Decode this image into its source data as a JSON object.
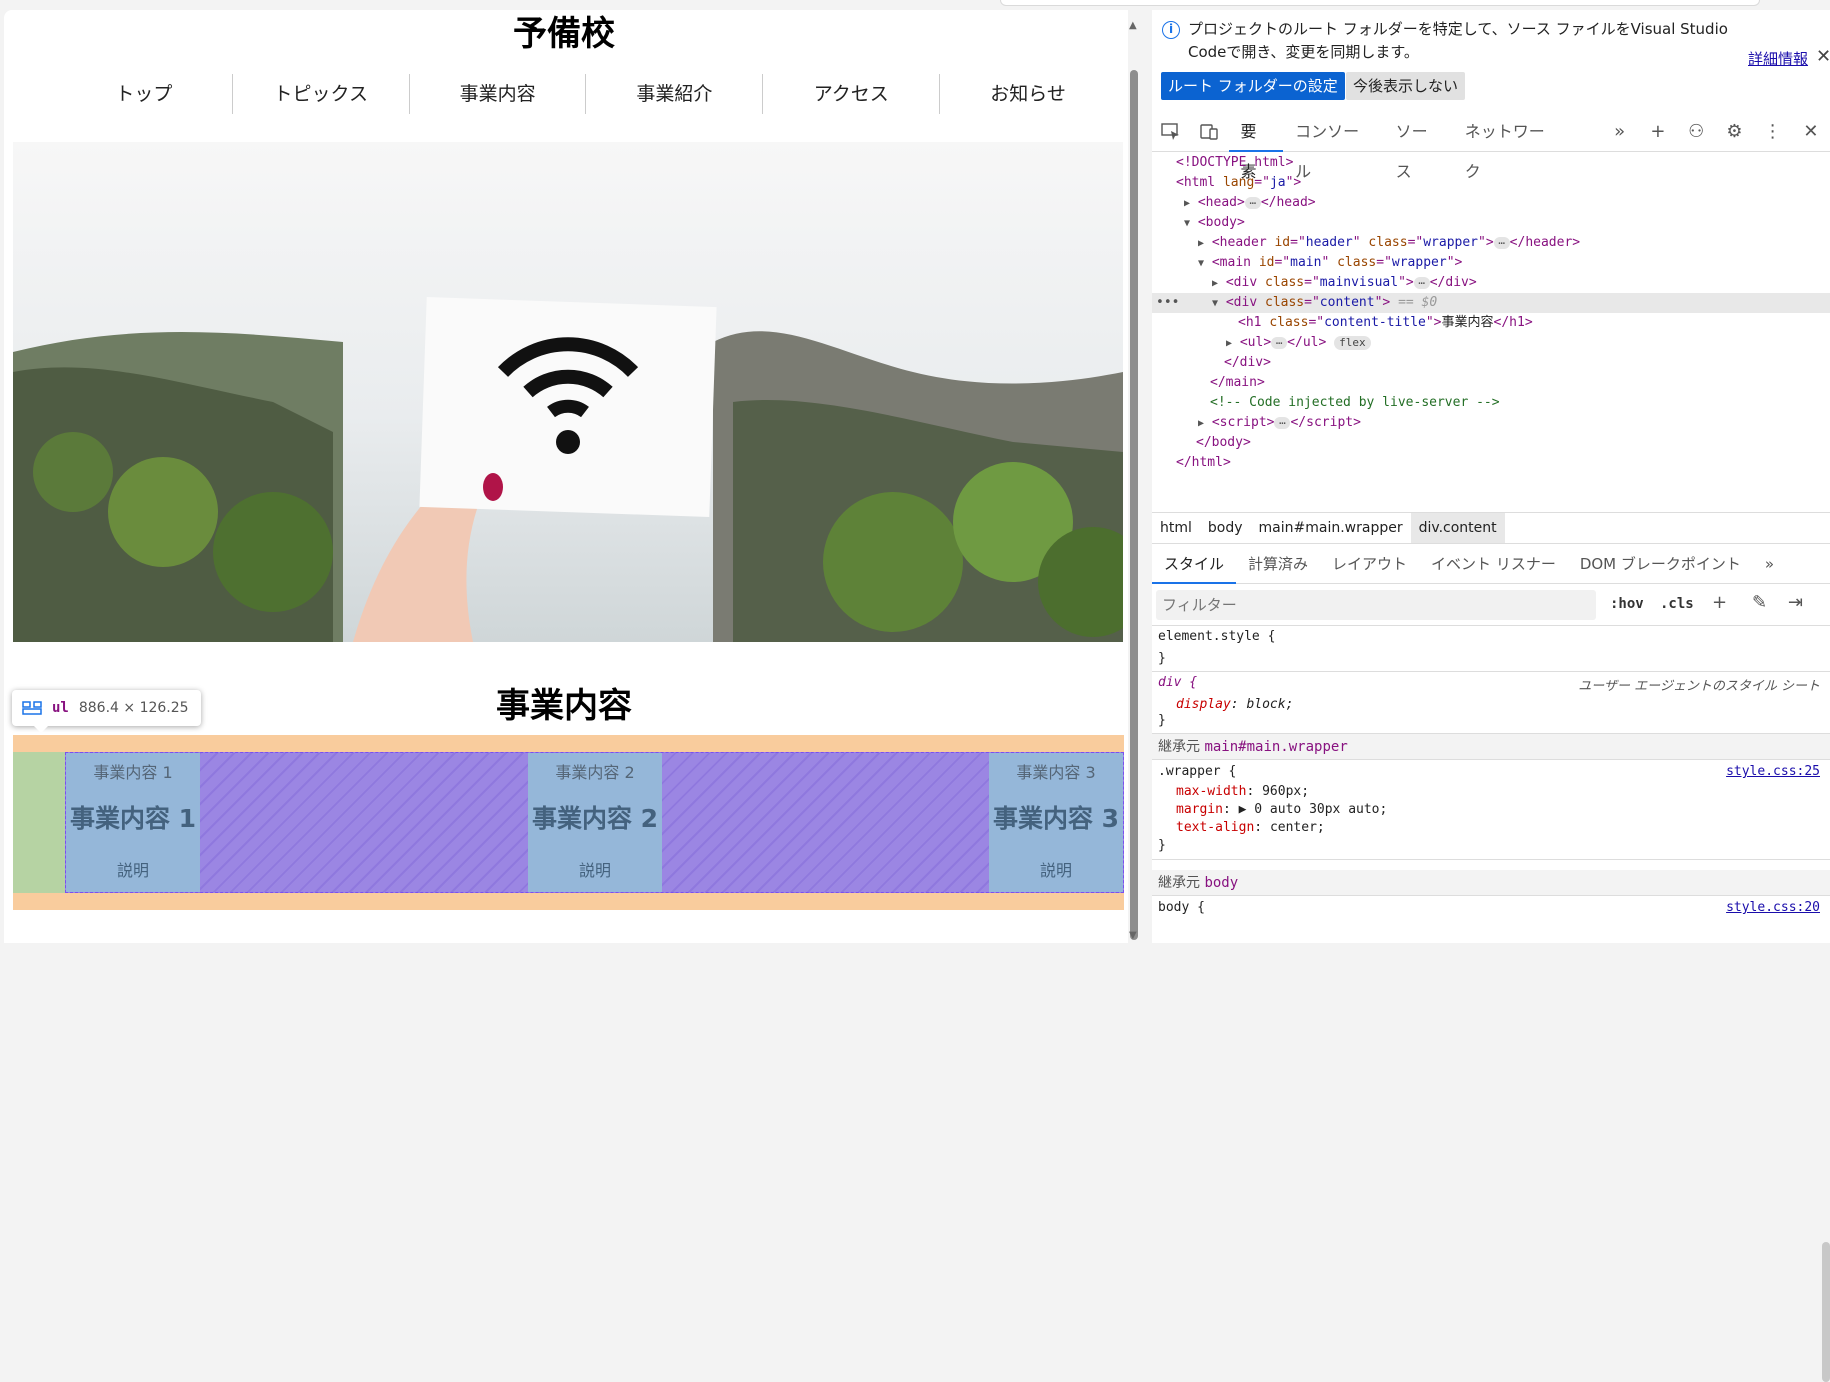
{
  "site": {
    "title": "予備校",
    "nav": [
      "トップ",
      "トピックス",
      "事業内容",
      "事業紹介",
      "アクセス",
      "お知らせ"
    ],
    "content_title": "事業内容",
    "items": [
      {
        "img_alt": "事業内容 1",
        "heading": "事業内容 1",
        "desc": "説明"
      },
      {
        "img_alt": "事業内容 2",
        "heading": "事業内容 2",
        "desc": "説明"
      },
      {
        "img_alt": "事業内容 3",
        "heading": "事業内容 3",
        "desc": "説明"
      }
    ]
  },
  "tooltip": {
    "tag": "ul",
    "size": "886.4 × 126.25"
  },
  "infobar": {
    "message": "プロジェクトのルート フォルダーを特定して、ソース ファイルをVisual Studio Codeで開き、変更を同期します。",
    "link": "詳細情報",
    "primary_button": "ルート フォルダーの設定",
    "secondary_button": "今後表示しない"
  },
  "toolbar": {
    "tabs": [
      "要素",
      "コンソール",
      "ソース",
      "ネットワーク"
    ],
    "active": "要素"
  },
  "dom": {
    "doctype": "<!DOCTYPE html>",
    "html_lang": "ja",
    "header_id": "header",
    "header_class": "wrapper",
    "main_id": "main",
    "main_class": "wrapper",
    "mainvisual_class": "mainvisual",
    "content_class": "content",
    "selected_marker": "== $0",
    "h1_class": "content-title",
    "h1_text": "事業内容",
    "ul_badge": "flex",
    "comment": "<!-- Code injected by live-server -->"
  },
  "breadcrumbs": [
    "html",
    "body",
    "main#main.wrapper",
    "div.content"
  ],
  "subtabs": [
    "スタイル",
    "計算済み",
    "レイアウト",
    "イベント リスナー",
    "DOM ブレークポイント"
  ],
  "filter": {
    "placeholder": "フィルター",
    "hov": ":hov",
    "cls": ".cls"
  },
  "styles": {
    "element_style": "element.style {",
    "div_selector": "div {",
    "ua_label": "ユーザー エージェントのスタイル シート",
    "div_prop": "display",
    "div_val": "block;",
    "inherit1_label": "継承元",
    "inherit1_target": "main#main.wrapper",
    "wrapper_selector": ".wrapper {",
    "wrapper_src": "style.css:25",
    "wrapper_props": [
      {
        "prop": "max-width",
        "val": "960px;"
      },
      {
        "prop": "margin",
        "val": "▶ 0 auto 30px auto;"
      },
      {
        "prop": "text-align",
        "val": "center;"
      }
    ],
    "inherit2_label": "継承元",
    "inherit2_target": "body",
    "body_selector": "body {",
    "body_src": "style.css:20"
  }
}
